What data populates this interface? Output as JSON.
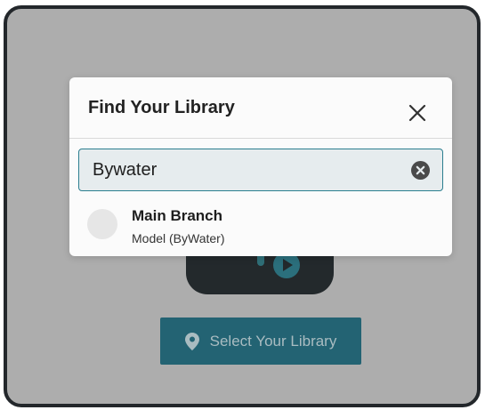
{
  "dialog": {
    "title": "Find Your Library",
    "close_icon": "close-icon",
    "search": {
      "value": "Bywater",
      "clear_icon": "clear-circle-icon"
    },
    "results": [
      {
        "name": "Main Branch",
        "subtitle": "Model (ByWater)"
      }
    ]
  },
  "background": {
    "select_button_label": "Select Your Library",
    "select_button_icon": "map-pin-icon"
  },
  "colors": {
    "overlay": "#adadad",
    "accent": "#236373",
    "search_border": "#2b7e8f",
    "frame": "#23272b"
  }
}
